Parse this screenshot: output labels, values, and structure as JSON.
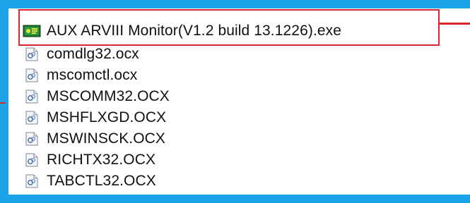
{
  "files": [
    {
      "name": "AUX ARVIII Monitor(V1.2 build 13.1226).exe",
      "icon": "exe-icon"
    },
    {
      "name": "comdlg32.ocx",
      "icon": "ocx-file-icon"
    },
    {
      "name": "mscomctl.ocx",
      "icon": "ocx-file-icon"
    },
    {
      "name": "MSCOMM32.OCX",
      "icon": "ocx-file-icon"
    },
    {
      "name": "MSHFLXGD.OCX",
      "icon": "ocx-file-icon"
    },
    {
      "name": "MSWINSCK.OCX",
      "icon": "ocx-file-icon"
    },
    {
      "name": "RICHTX32.OCX",
      "icon": "ocx-file-icon"
    },
    {
      "name": "TABCTL32.OCX",
      "icon": "ocx-file-icon"
    }
  ],
  "colors": {
    "frame": "#1aa3e8",
    "highlight": "#d9252b"
  }
}
